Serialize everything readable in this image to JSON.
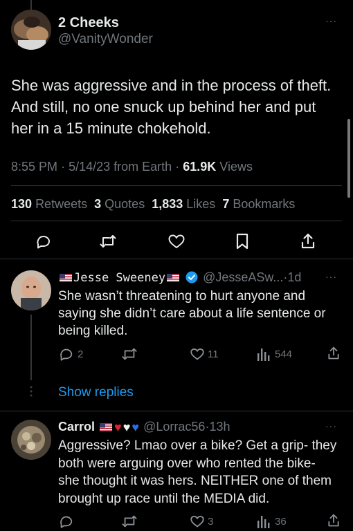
{
  "main_tweet": {
    "display_name": "2 Cheeks",
    "handle": "@VanityWonder",
    "text_lines": [
      "She was aggressive and in the process of theft.",
      "And still, no one snuck up behind her and put",
      "her in a 15 minute chokehold."
    ],
    "time": "8:55 PM",
    "date": "5/14/23",
    "source": "from Earth",
    "views_count": "61.9K",
    "views_label": "Views",
    "stats": {
      "retweets_count": "130",
      "retweets_label": "Retweets",
      "quotes_count": "3",
      "quotes_label": "Quotes",
      "likes_count": "1,833",
      "likes_label": "Likes",
      "bookmarks_count": "7",
      "bookmarks_label": "Bookmarks"
    }
  },
  "replies": [
    {
      "display_name": "Jesse Sweeney",
      "handle": "@JesseASw...",
      "age": "1d",
      "text_lines": [
        "She wasn’t threatening to hurt anyone and",
        "saying she didn’t care about a life sentence or",
        "being killed."
      ],
      "reply_count": "2",
      "like_count": "11",
      "view_count": "544"
    },
    {
      "display_name": "Carrol",
      "handle": "@Lorrac56",
      "age": "13h",
      "text_lines": [
        "Aggressive? Lmao over a bike? Get a grip- they",
        "both were arguing over who rented the bike-",
        "she thought it was hers. NEITHER one of them",
        "brought up race until the MEDIA did."
      ],
      "like_count": "3",
      "view_count": "36"
    }
  ],
  "show_replies_label": "Show replies",
  "dot_separator": "·",
  "more_label": "···",
  "colors": {
    "background": "#000000",
    "text": "#e7e9ea",
    "muted": "#71767b",
    "divider": "#2f3336",
    "accent_blue": "#1d9bf0",
    "verified": "#1d9bf0"
  }
}
